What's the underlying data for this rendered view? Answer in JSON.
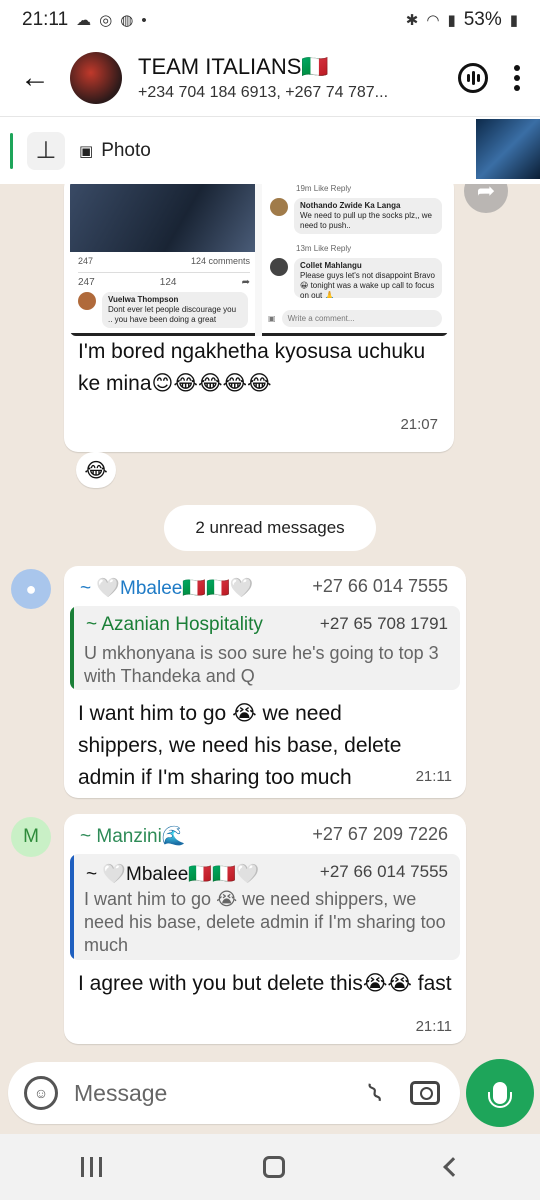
{
  "status_bar": {
    "time": "21:11",
    "battery": "53%"
  },
  "header": {
    "title": "TEAM ITALIANS🇮🇹",
    "subtitle": "+234 704 184 6913, +267 74 787..."
  },
  "pinned": {
    "label": "Photo"
  },
  "image_message": {
    "screenshot": {
      "reaction_count": "247",
      "comments_count": "124 comments",
      "like_count": "247",
      "comment_count_action": "124",
      "comment1_name": "Vuelwa Thompson",
      "comment1_text": "Dont ever let people discourage you .. you have been doing a great",
      "meta_top": "19m   Like   Reply",
      "comment2_name": "Nothando Zwide Ka Langa",
      "comment2_text": "We need to pull up the socks plz,, we need to push..",
      "meta_mid": "13m   Like   Reply",
      "comment3_name": "Collet Mahlangu",
      "comment3_text": "Please guys let's not disappoint Bravo 😀 tonight was a wake up call to focus on out 🙏",
      "write_placeholder": "Write a comment..."
    },
    "text": "I'm bored  ngakhetha kyosusa uchuku ke mina😊😂😂😂😂",
    "time": "21:07",
    "reaction": "😂"
  },
  "unread_banner": "2 unread messages",
  "messages": [
    {
      "avatar_letter": "",
      "sender": "~ 🤍Mbalee🇮🇹🇮🇹🤍",
      "sender_color": "#1f7bc6",
      "number": "+27 66 014 7555",
      "quote": {
        "name": "~ Azanian Hospitality",
        "name_color": "#1a7f37",
        "number": "+27 65 708 1791",
        "text": "U mkhonyana is soo sure he's going to top 3 with Thandeka and Q",
        "bar_color": "#1a7f37"
      },
      "text": "I want him to go 😭 we need shippers, we need his base, delete admin if  I'm sharing too much",
      "time": "21:11"
    },
    {
      "avatar_letter": "M",
      "sender": "~ Manzini🌊",
      "sender_color": "#2e8b57",
      "number": "+27 67 209 7226",
      "quote": {
        "name": "~ 🤍Mbalee🇮🇹🇮🇹🤍",
        "name_color": "#111111",
        "number": "+27 66 014 7555",
        "text": "I want him to go 😭 we need shippers, we need his base, delete admin if  I'm sharing too much",
        "bar_color": "#1f5fbf"
      },
      "text": "I agree with you but delete this😭😭 fast",
      "time": "21:11"
    }
  ],
  "composer": {
    "placeholder": "Message"
  },
  "colors": {
    "accent": "#1ea55a",
    "chat_bg": "#efe7de"
  }
}
